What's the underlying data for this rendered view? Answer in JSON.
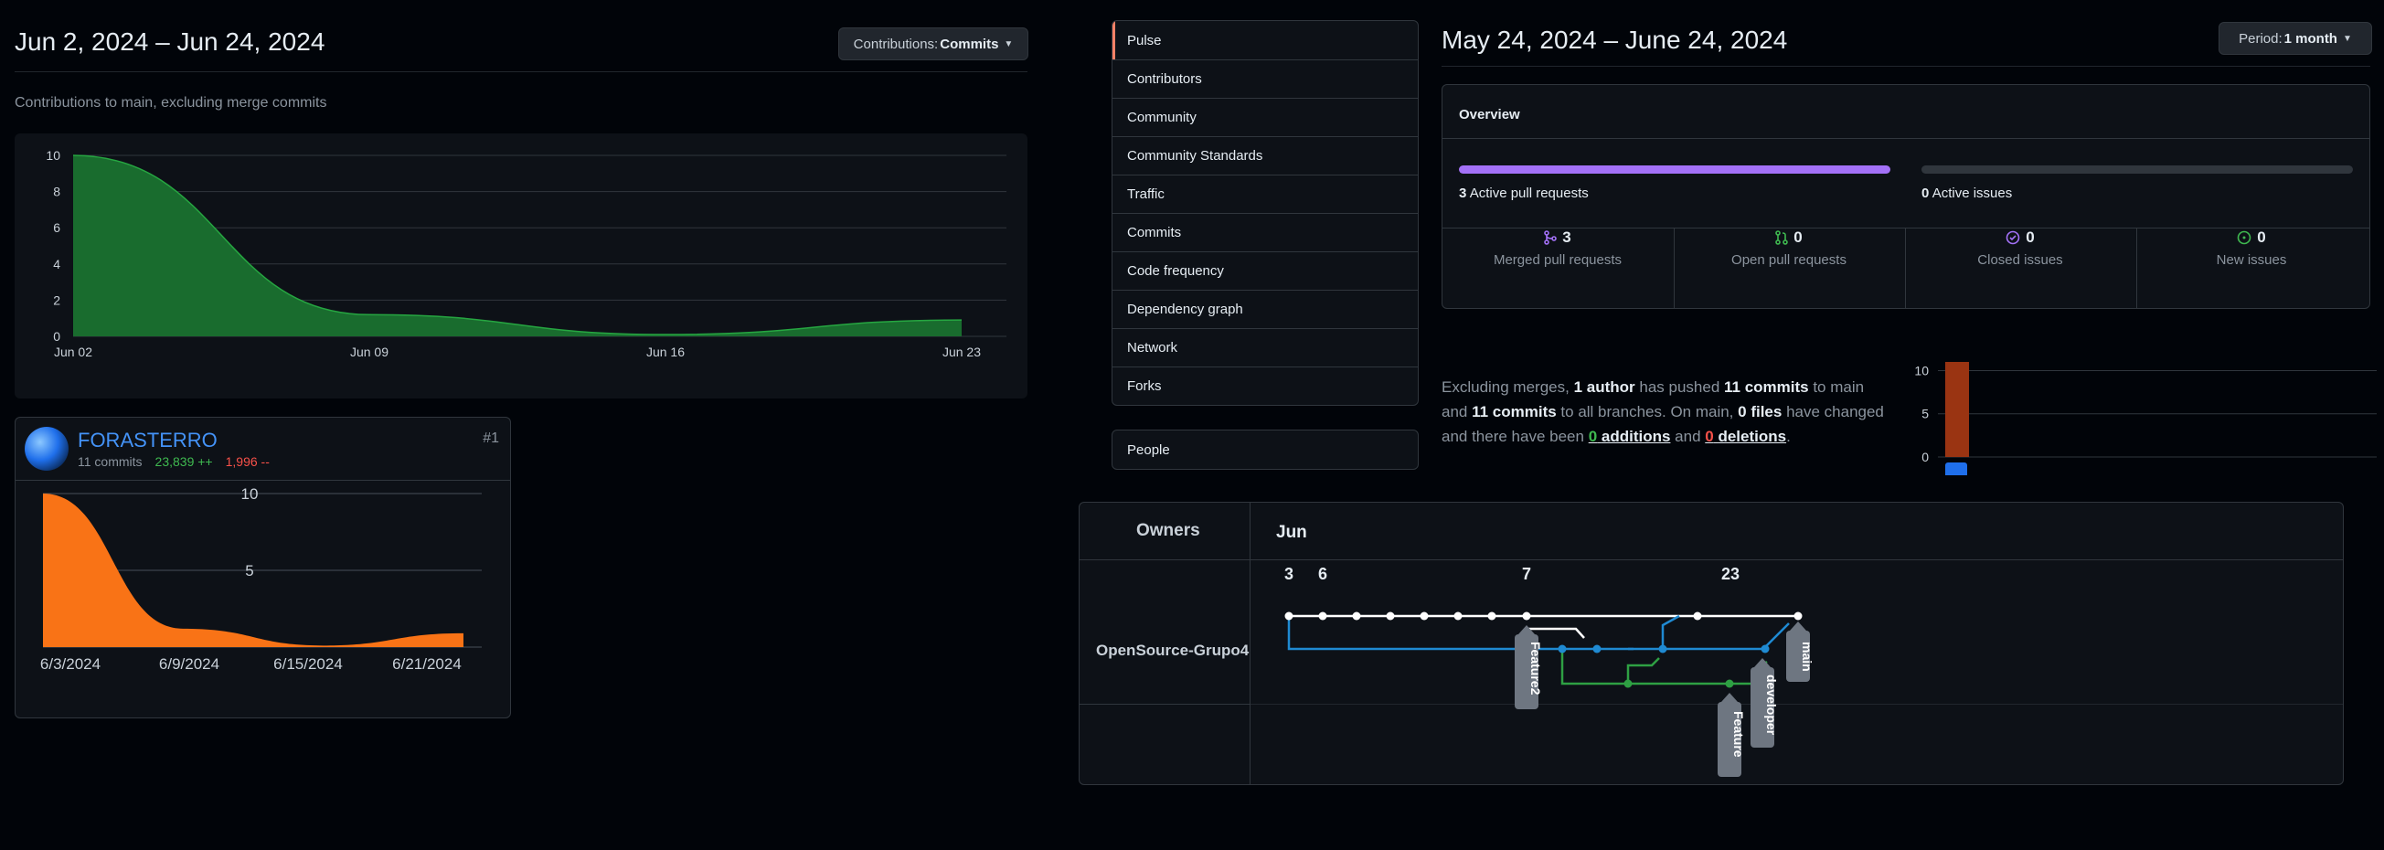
{
  "left": {
    "date_range": "Jun 2, 2024 – Jun 24, 2024",
    "contrib_button": {
      "prefix": "Contributions:",
      "value": "Commits"
    },
    "subtitle": "Contributions to main, excluding merge commits"
  },
  "contributor": {
    "name": "FORASTERRO",
    "rank": "#1",
    "commits": "11 commits",
    "additions": "23,839 ++",
    "deletions": "1,996 --"
  },
  "right": {
    "date_range": "May 24, 2024 – June 24, 2024",
    "period_button": {
      "prefix": "Period:",
      "value": "1 month"
    },
    "nav": [
      "Pulse",
      "Contributors",
      "Community",
      "Community Standards",
      "Traffic",
      "Commits",
      "Code frequency",
      "Dependency graph",
      "Network",
      "Forks"
    ],
    "nav_people": "People",
    "overview": {
      "title": "Overview",
      "active_prs_count": "3",
      "active_prs_label": "Active pull requests",
      "active_issues_count": "0",
      "active_issues_label": "Active issues",
      "stats": [
        {
          "num": "3",
          "label": "Merged pull requests",
          "icon": "merge-icon",
          "color": "#a371f7"
        },
        {
          "num": "0",
          "label": "Open pull requests",
          "icon": "pr-icon",
          "color": "#3fb950"
        },
        {
          "num": "0",
          "label": "Closed issues",
          "icon": "check-circle-icon",
          "color": "#a371f7"
        },
        {
          "num": "0",
          "label": "New issues",
          "icon": "issue-icon",
          "color": "#3fb950"
        }
      ]
    },
    "summary": {
      "t1": "Excluding merges, ",
      "b1": "1 author",
      "t2": " has pushed ",
      "b2": "11 commits",
      "t3": " to main",
      "b3": "11 commits",
      "t4": " to all branches. On main, ",
      "b4": "0 files",
      "t5": " have changed",
      "t6": "and there have been ",
      "add_num": "0",
      "add_word": "additions",
      "t7": " and ",
      "del_num": "0",
      "del_word": "deletions",
      "t8": "."
    }
  },
  "network": {
    "owners_header": "Owners",
    "month": "Jun",
    "owner": "OpenSource-Grupo4",
    "dates": [
      "3",
      "6",
      "7",
      "23"
    ],
    "branches": [
      "Feature2",
      "Feature",
      "developer",
      "main"
    ]
  },
  "colors": {
    "accent_green": "#0e4429",
    "area_green": "#196c2e",
    "orange": "#f97316",
    "purple": "#a371f7",
    "blue": "#1f6feb"
  },
  "chart_data": [
    {
      "type": "area",
      "title": "",
      "x": [
        "Jun 02",
        "Jun 09",
        "Jun 16",
        "Jun 23"
      ],
      "series": [
        {
          "values": [
            10,
            1.2,
            0.1,
            0.9
          ]
        }
      ],
      "ylim": [
        0,
        10
      ],
      "yticks": [
        0,
        2,
        4,
        6,
        8,
        10
      ],
      "grid": true
    },
    {
      "type": "area",
      "title": "",
      "x": [
        "6/3/2024",
        "6/9/2024",
        "6/15/2024",
        "6/21/2024"
      ],
      "series": [
        {
          "values": [
            10,
            1.2,
            0.1,
            0.9
          ]
        }
      ],
      "ylim": [
        0,
        10
      ],
      "yticks": [
        5,
        10
      ],
      "grid": true
    },
    {
      "type": "bar",
      "categories": [
        ""
      ],
      "values": [
        11
      ],
      "ylim": [
        0,
        11
      ],
      "yticks": [
        0,
        5,
        10
      ]
    }
  ]
}
